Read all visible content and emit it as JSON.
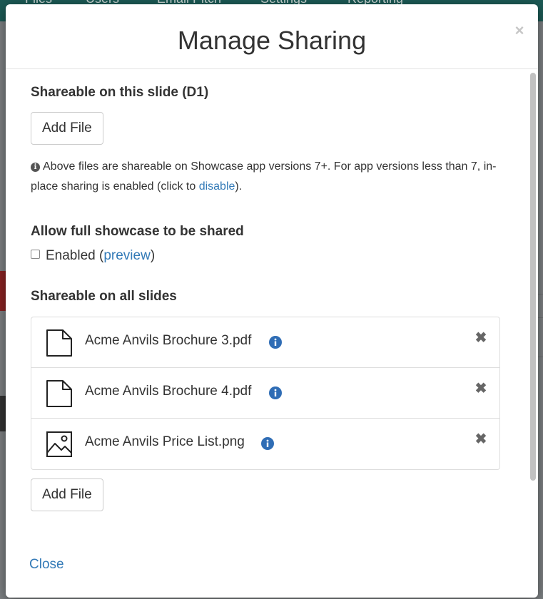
{
  "background": {
    "nav_items": [
      "Files",
      "Users",
      "Email Pitch",
      "Settings",
      "Reporting"
    ]
  },
  "modal": {
    "title": "Manage Sharing",
    "close_symbol": "×",
    "close_icon": "close-icon"
  },
  "slide_section": {
    "heading": "Shareable on this slide (D1)",
    "add_file_label": "Add File",
    "help_icon": "info-circle-icon",
    "help_text_before": "Above files are shareable on Showcase app versions 7+. For app versions less than 7, in-place sharing is enabled (click to ",
    "help_link": "disable",
    "help_text_after": ")."
  },
  "full_showcase": {
    "heading": "Allow full showcase to be shared",
    "checkbox_label": "Enabled (",
    "checkbox_checked": false,
    "preview_link": "preview",
    "after_link": ")"
  },
  "all_slides_section": {
    "heading": "Shareable on all slides",
    "files": [
      {
        "name": "Acme Anvils Brochure 3.pdf",
        "icon": "document-icon"
      },
      {
        "name": "Acme Anvils Brochure 4.pdf",
        "icon": "document-icon"
      },
      {
        "name": "Acme Anvils Price List.png",
        "icon": "image-icon"
      }
    ],
    "info_icon": "info-icon",
    "remove_symbol": "✖",
    "add_file_label": "Add File"
  },
  "footer": {
    "close_label": "Close"
  },
  "colors": {
    "link": "#337ab7",
    "info_blue": "#2f6db5",
    "backdrop": "#6b6f72"
  }
}
